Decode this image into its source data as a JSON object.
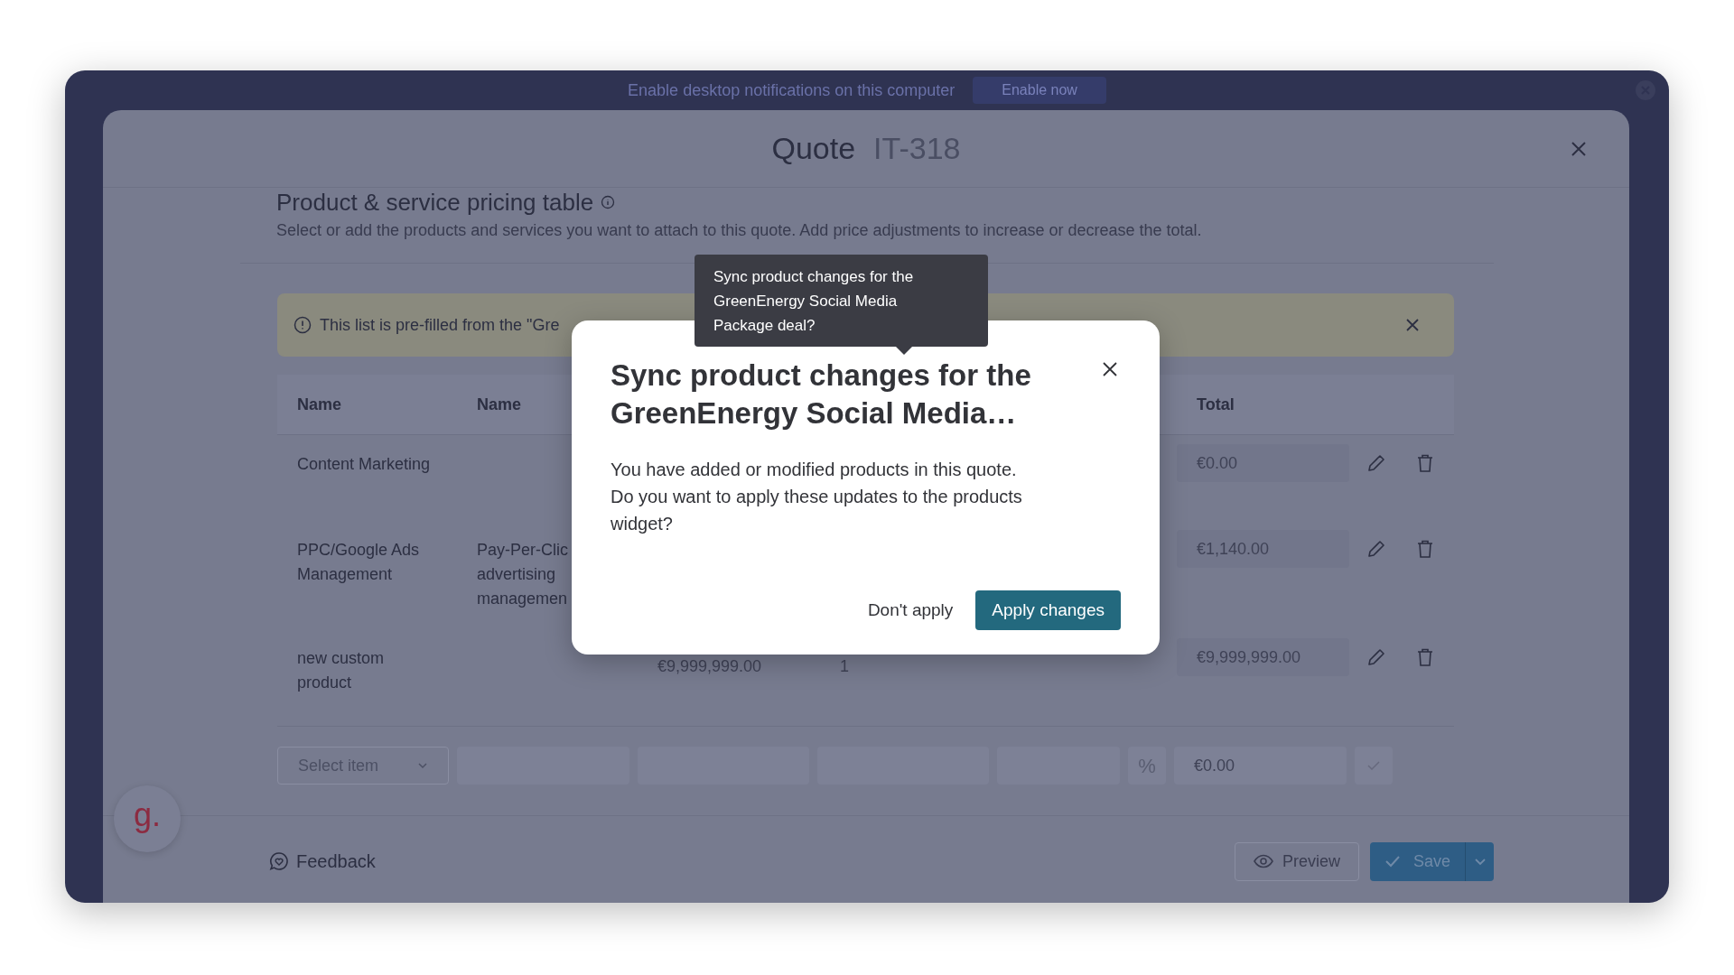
{
  "notification_bar": {
    "text": "Enable desktop notifications on this computer",
    "button": "Enable now"
  },
  "modal": {
    "title": "Quote",
    "number": "IT-318"
  },
  "section": {
    "title": "Product & service pricing table",
    "description": "Select or add the products and services you want to attach to this quote. Add price adjustments to increase or decrease the total."
  },
  "banner": {
    "text": "This list is pre-filled from the \"Gre"
  },
  "table": {
    "columns": [
      "Name",
      "Name",
      "Total"
    ],
    "rows": [
      {
        "name": "Content Marketing",
        "total": "€0.00"
      },
      {
        "name": "PPC/Google Ads Management",
        "description": "Pay-Per-Clic advertising managemen",
        "total": "€1,140.00"
      },
      {
        "name": "new custom product",
        "price": "€9,999,999.00",
        "quantity": "1",
        "total": "€9,999,999.00"
      }
    ]
  },
  "new_item_row": {
    "select_placeholder": "Select item",
    "percent": "%",
    "total": "€0.00"
  },
  "avatar": {
    "letter": "g."
  },
  "footer": {
    "feedback": "Feedback",
    "preview": "Preview",
    "save": "Save"
  },
  "dialog": {
    "title": "Sync product changes for the GreenEnergy Social Media…",
    "body": "You have added or modified products in this quote. Do you want to apply these updates to the products widget?",
    "buttons": [
      {
        "label": "Don't apply",
        "kind": "secondary"
      },
      {
        "label": "Apply changes",
        "kind": "primary"
      }
    ]
  },
  "tooltip": {
    "text": "Sync product changes for the GreenEnergy Social Media Package deal?"
  }
}
